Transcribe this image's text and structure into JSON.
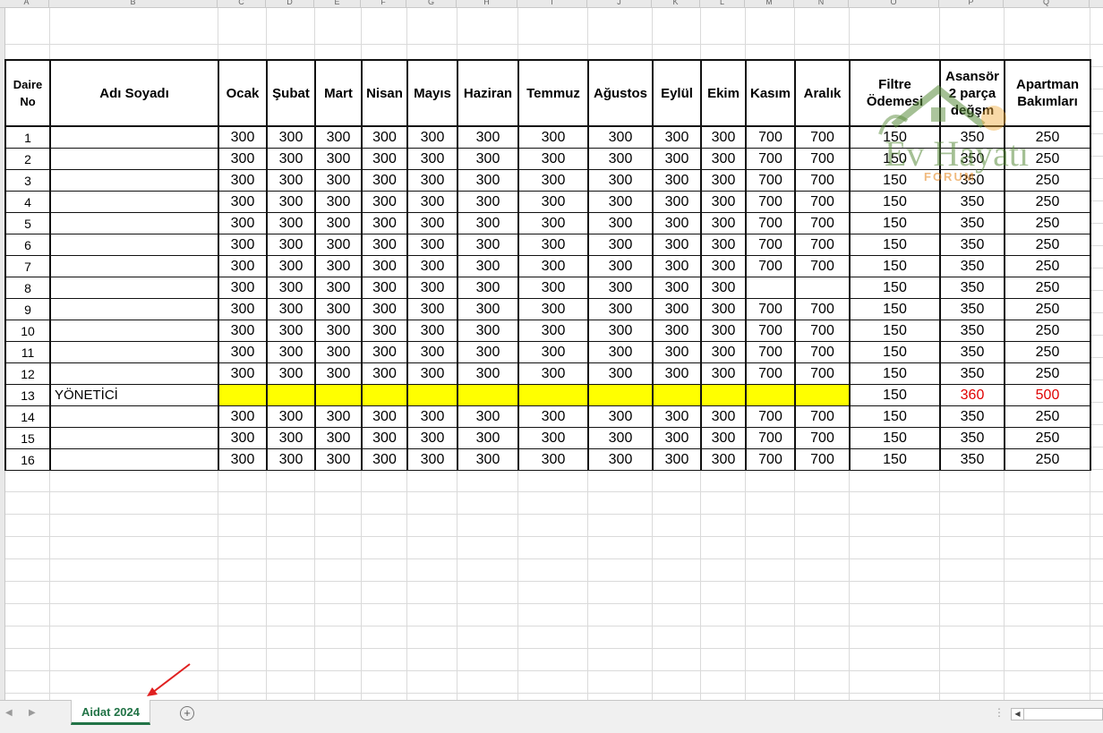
{
  "column_letters": [
    "A",
    "B",
    "C",
    "D",
    "E",
    "F",
    "G",
    "H",
    "I",
    "J",
    "K",
    "L",
    "M",
    "N",
    "O",
    "P",
    "Q"
  ],
  "table": {
    "headers": [
      "Daire No",
      "Adı Soyadı",
      "Ocak",
      "Şubat",
      "Mart",
      "Nisan",
      "Mayıs",
      "Haziran",
      "Temmuz",
      "Ağustos",
      "Eylül",
      "Ekim",
      "Kasım",
      "Aralık",
      "Filtre Ödemesi",
      "Asansör 2 parça değşm",
      "Apartman Bakımları"
    ],
    "rows": [
      [
        "1",
        "",
        "300",
        "300",
        "300",
        "300",
        "300",
        "300",
        "300",
        "300",
        "300",
        "300",
        "700",
        "700",
        "150",
        "350",
        "250"
      ],
      [
        "2",
        "",
        "300",
        "300",
        "300",
        "300",
        "300",
        "300",
        "300",
        "300",
        "300",
        "300",
        "700",
        "700",
        "150",
        "350",
        "250"
      ],
      [
        "3",
        "",
        "300",
        "300",
        "300",
        "300",
        "300",
        "300",
        "300",
        "300",
        "300",
        "300",
        "700",
        "700",
        "150",
        "350",
        "250"
      ],
      [
        "4",
        "",
        "300",
        "300",
        "300",
        "300",
        "300",
        "300",
        "300",
        "300",
        "300",
        "300",
        "700",
        "700",
        "150",
        "350",
        "250"
      ],
      [
        "5",
        "",
        "300",
        "300",
        "300",
        "300",
        "300",
        "300",
        "300",
        "300",
        "300",
        "300",
        "700",
        "700",
        "150",
        "350",
        "250"
      ],
      [
        "6",
        "",
        "300",
        "300",
        "300",
        "300",
        "300",
        "300",
        "300",
        "300",
        "300",
        "300",
        "700",
        "700",
        "150",
        "350",
        "250"
      ],
      [
        "7",
        "",
        "300",
        "300",
        "300",
        "300",
        "300",
        "300",
        "300",
        "300",
        "300",
        "300",
        "700",
        "700",
        "150",
        "350",
        "250"
      ],
      [
        "8",
        "",
        "300",
        "300",
        "300",
        "300",
        "300",
        "300",
        "300",
        "300",
        "300",
        "300",
        "",
        "",
        "150",
        "350",
        "250"
      ],
      [
        "9",
        "",
        "300",
        "300",
        "300",
        "300",
        "300",
        "300",
        "300",
        "300",
        "300",
        "300",
        "700",
        "700",
        "150",
        "350",
        "250"
      ],
      [
        "10",
        "",
        "300",
        "300",
        "300",
        "300",
        "300",
        "300",
        "300",
        "300",
        "300",
        "300",
        "700",
        "700",
        "150",
        "350",
        "250"
      ],
      [
        "11",
        "",
        "300",
        "300",
        "300",
        "300",
        "300",
        "300",
        "300",
        "300",
        "300",
        "300",
        "700",
        "700",
        "150",
        "350",
        "250"
      ],
      [
        "12",
        "",
        "300",
        "300",
        "300",
        "300",
        "300",
        "300",
        "300",
        "300",
        "300",
        "300",
        "700",
        "700",
        "150",
        "350",
        "250"
      ],
      [
        "13",
        "YÖNETİCİ",
        "",
        "",
        "",
        "",
        "",
        "",
        "",
        "",
        "",
        "",
        "",
        "",
        "150",
        "360",
        "500"
      ],
      [
        "14",
        "",
        "300",
        "300",
        "300",
        "300",
        "300",
        "300",
        "300",
        "300",
        "300",
        "300",
        "700",
        "700",
        "150",
        "350",
        "250"
      ],
      [
        "15",
        "",
        "300",
        "300",
        "300",
        "300",
        "300",
        "300",
        "300",
        "300",
        "300",
        "300",
        "700",
        "700",
        "150",
        "350",
        "250"
      ],
      [
        "16",
        "",
        "300",
        "300",
        "300",
        "300",
        "300",
        "300",
        "300",
        "300",
        "300",
        "300",
        "700",
        "700",
        "150",
        "350",
        "250"
      ]
    ],
    "highlight_row": "13",
    "highlight_color": "#ffff00",
    "red_text_color": "#e00000"
  },
  "watermark": {
    "title": "Ev Hayatı",
    "subtitle": "FORUM"
  },
  "sheet_tabs": {
    "active_tab": "Aidat 2024",
    "accent_color": "#217346"
  },
  "icons": {
    "add_sheet": "plus-circle-icon",
    "scroll_left": "chevron-left-icon",
    "scroll_right": "chevron-right-icon",
    "annotation": "red-arrow-icon"
  }
}
